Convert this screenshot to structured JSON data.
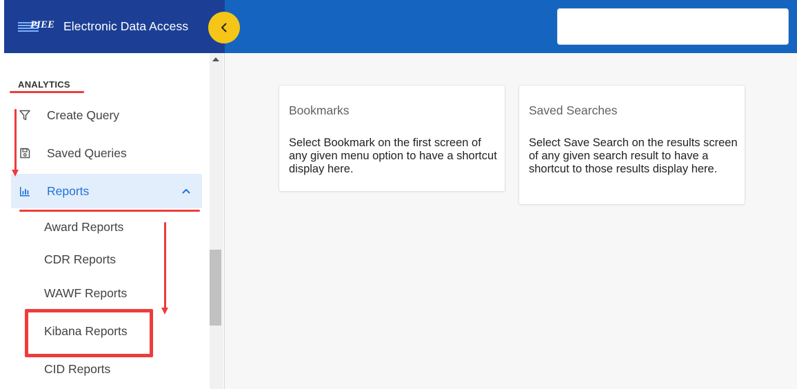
{
  "header": {
    "logo_text": "PIEE",
    "app_title": "Electronic Data Access",
    "search_value": ""
  },
  "sidebar": {
    "section_title": "ANALYTICS",
    "items": [
      {
        "label": "Create Query",
        "icon": "filter-icon"
      },
      {
        "label": "Saved Queries",
        "icon": "save-icon"
      },
      {
        "label": "Reports",
        "icon": "bar-chart-icon",
        "expanded": true
      }
    ],
    "reports_children": [
      {
        "label": "Award Reports"
      },
      {
        "label": "CDR Reports"
      },
      {
        "label": "WAWF Reports"
      },
      {
        "label": "Kibana Reports"
      },
      {
        "label": "CID Reports"
      }
    ]
  },
  "cards": [
    {
      "title": "Bookmarks",
      "body": "Select Bookmark on the first screen of any given menu option to have a shortcut display here."
    },
    {
      "title": "Saved Searches",
      "body": "Select Save Search on the results screen of any given search result to have a shortcut to those results display here."
    }
  ],
  "colors": {
    "sidebar_header": "#1c3f95",
    "topbar": "#1565c0",
    "accent": "#1e73d8",
    "collapse_button": "#f5c518",
    "annotation": "#ef3b3b"
  }
}
